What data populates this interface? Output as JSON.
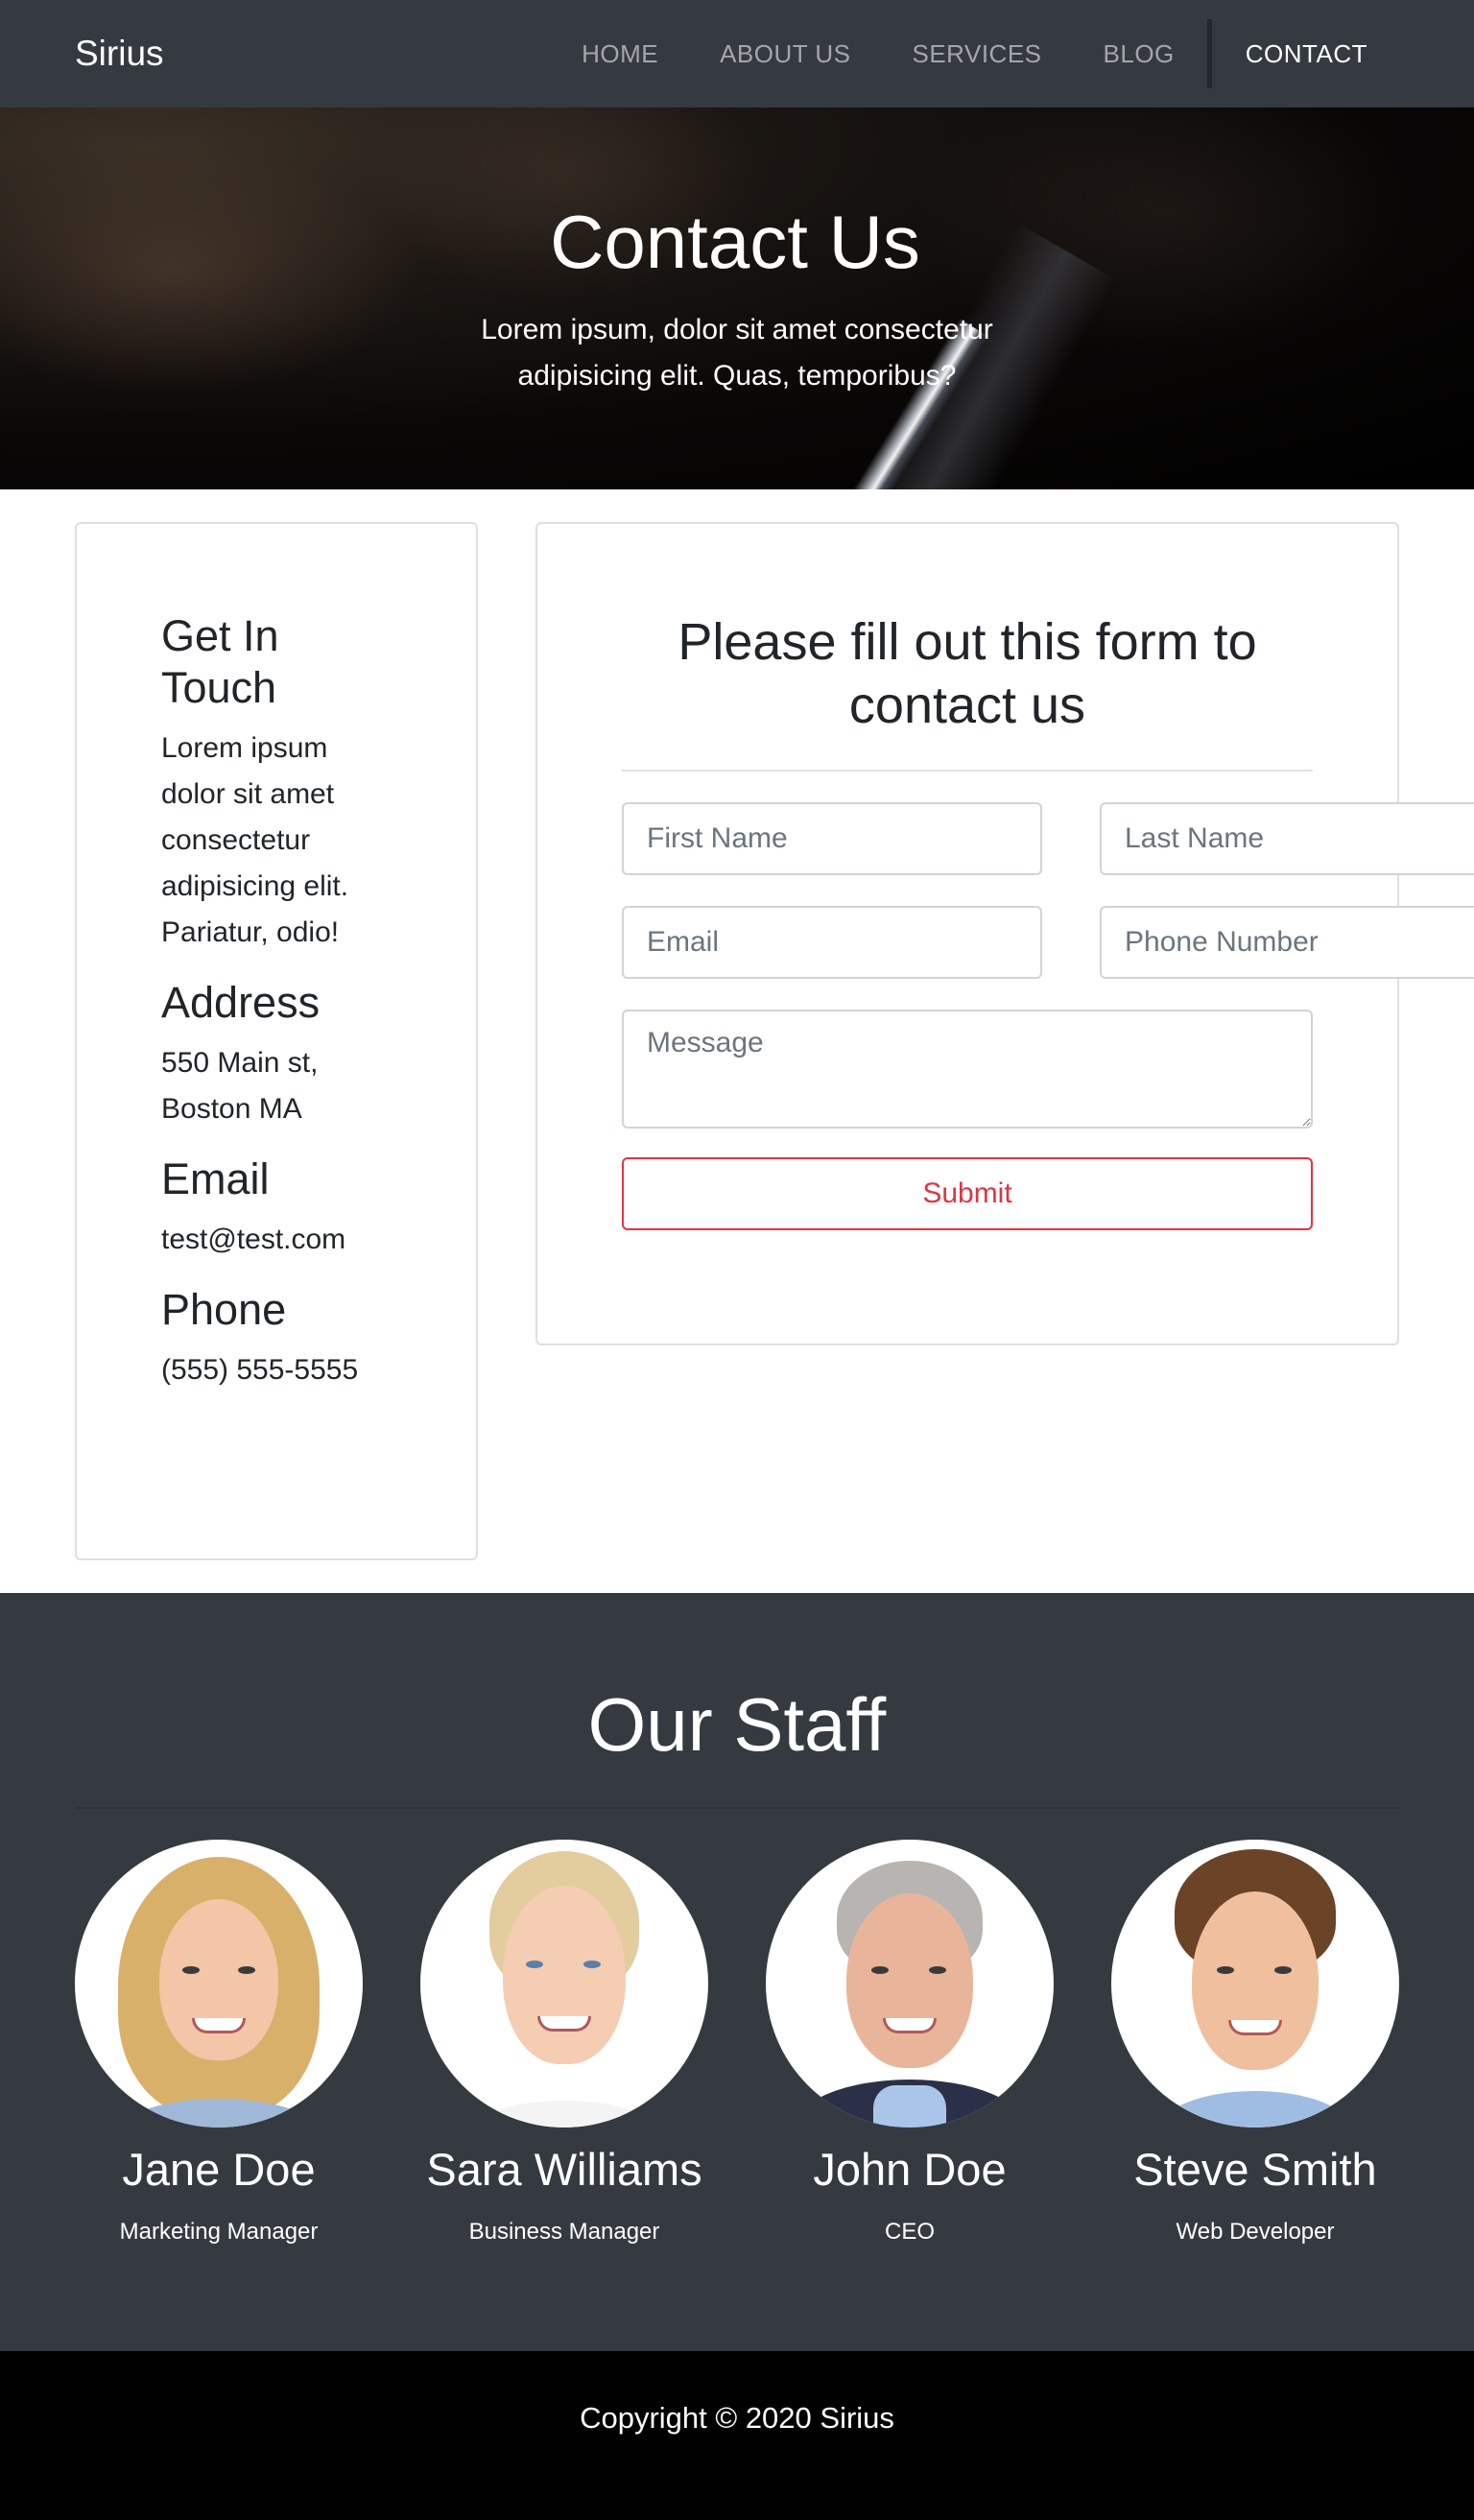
{
  "navbar": {
    "brand": "Sirius",
    "links": [
      "HOME",
      "ABOUT US",
      "SERVICES",
      "BLOG",
      "CONTACT"
    ],
    "active_link": "CONTACT"
  },
  "hero": {
    "title": "Contact Us",
    "subtitle": "Lorem ipsum, dolor sit amet consectetur adipisicing elit. Quas, temporibus?"
  },
  "info": {
    "get_in_touch_heading": "Get In Touch",
    "get_in_touch_text": "Lorem ipsum dolor sit amet consectetur adipisicing elit. Pariatur, odio!",
    "address_heading": "Address",
    "address_text": "550 Main st, Boston MA",
    "email_heading": "Email",
    "email_text": "test@test.com",
    "phone_heading": "Phone",
    "phone_text": "(555) 555-5555"
  },
  "form": {
    "heading": "Please fill out this form to contact us",
    "first_name_placeholder": "First Name",
    "last_name_placeholder": "Last Name",
    "email_placeholder": "Email",
    "phone_placeholder": "Phone Number",
    "message_placeholder": "Message",
    "submit_label": "Submit"
  },
  "staff": {
    "heading": "Our Staff",
    "members": [
      {
        "name": "Jane Doe",
        "role": "Marketing Manager"
      },
      {
        "name": "Sara Williams",
        "role": "Business Manager"
      },
      {
        "name": "John Doe",
        "role": "CEO"
      },
      {
        "name": "Steve Smith",
        "role": "Web Developer"
      }
    ]
  },
  "footer": {
    "copyright": "Copyright © 2020 Sirius"
  },
  "colors": {
    "navbar_bg": "#343a40",
    "submit_accent": "#dc3545",
    "footer_bg": "#000000"
  }
}
